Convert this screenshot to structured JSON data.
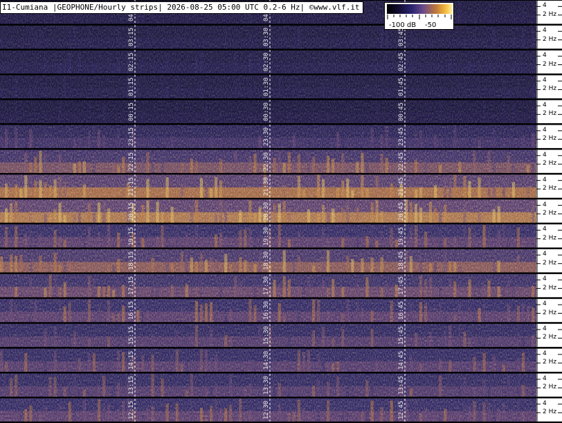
{
  "title": "I1-Cumiana |GEOPHONE/Hourly strips| 2026-08-25 05:00 UTC 0.2-6 Hz| ©www.vlf.it",
  "legend": {
    "min_label": "-100 dB",
    "max_label": "-50"
  },
  "chart_data": {
    "type": "heatmap",
    "title": "I1-Cumiana |GEOPHONE/Hourly strips| 2026-08-25 05:00 UTC 0.2-6 Hz| ©www.vlf.it",
    "frequency_range_hz": [
      0.2,
      6
    ],
    "y_ticks": [
      "4",
      "2 Hz"
    ],
    "y_tick_values": [
      4,
      2
    ],
    "colorbar": {
      "min_db": -100,
      "max_db": -50,
      "labels": [
        "-100 dB",
        "-50"
      ]
    },
    "grid": true,
    "strips": [
      {
        "hour": "04",
        "time_labels": [
          "04",
          "04"
        ],
        "intensity": 0.15
      },
      {
        "hour": "03",
        "time_labels": [
          "03:15",
          "03:30",
          "03:45"
        ],
        "intensity": 0.18
      },
      {
        "hour": "02",
        "time_labels": [
          "02:15",
          "02:30",
          "02:45"
        ],
        "intensity": 0.2
      },
      {
        "hour": "01",
        "time_labels": [
          "01:15",
          "01:30",
          "01:45"
        ],
        "intensity": 0.18
      },
      {
        "hour": "00",
        "time_labels": [
          "00:15",
          "00:30",
          "00:45"
        ],
        "intensity": 0.15
      },
      {
        "hour": "23",
        "time_labels": [
          "23:15",
          "23:30",
          "23:45"
        ],
        "intensity": 0.4
      },
      {
        "hour": "22",
        "time_labels": [
          "22:15",
          "22:30",
          "22:45"
        ],
        "intensity": 0.65
      },
      {
        "hour": "21",
        "time_labels": [
          "21:15",
          "21:30",
          "21:45"
        ],
        "intensity": 0.8
      },
      {
        "hour": "20",
        "time_labels": [
          "20:15",
          "20:30",
          "20:45"
        ],
        "intensity": 0.85
      },
      {
        "hour": "19",
        "time_labels": [
          "19:15",
          "19:30",
          "19:45"
        ],
        "intensity": 0.55
      },
      {
        "hour": "18",
        "time_labels": [
          "18:15",
          "18:30",
          "18:45"
        ],
        "intensity": 0.7
      },
      {
        "hour": "17",
        "time_labels": [
          "17:15",
          "17:30",
          "17:45"
        ],
        "intensity": 0.6
      },
      {
        "hour": "16",
        "time_labels": [
          "16:15",
          "16:30",
          "16:45"
        ],
        "intensity": 0.55
      },
      {
        "hour": "15",
        "time_labels": [
          "15:15",
          "15:30",
          "15:45"
        ],
        "intensity": 0.5
      },
      {
        "hour": "14",
        "time_labels": [
          "14:15",
          "14:30",
          "14:45"
        ],
        "intensity": 0.52
      },
      {
        "hour": "13",
        "time_labels": [
          "13:15",
          "13:30",
          "13:45"
        ],
        "intensity": 0.5
      },
      {
        "hour": "12",
        "time_labels": [
          "12:15",
          "12:30",
          "12:45"
        ],
        "intensity": 0.55
      }
    ]
  }
}
